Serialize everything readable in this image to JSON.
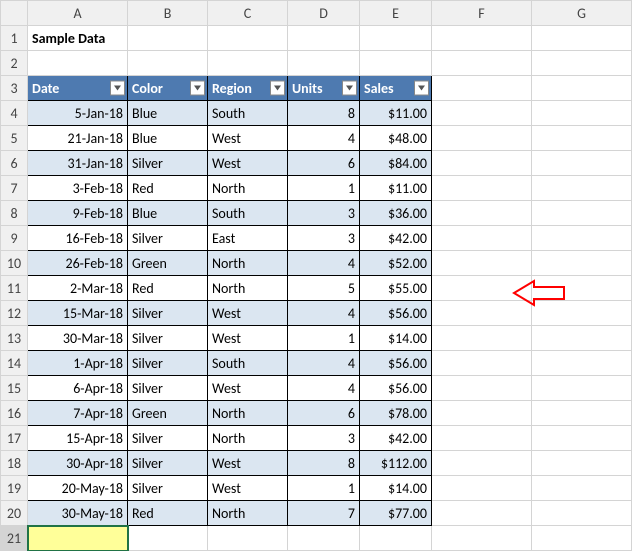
{
  "title_cell": "Sample Data",
  "columns": [
    "A",
    "B",
    "C",
    "D",
    "E",
    "F",
    "G"
  ],
  "row_numbers": [
    1,
    2,
    3,
    4,
    5,
    6,
    7,
    8,
    9,
    10,
    11,
    12,
    13,
    14,
    15,
    16,
    17,
    18,
    19,
    20,
    21
  ],
  "headers": {
    "date": "Date",
    "color": "Color",
    "region": "Region",
    "units": "Units",
    "sales": "Sales"
  },
  "rows": [
    {
      "date": "5-Jan-18",
      "color": "Blue",
      "region": "South",
      "units": "8",
      "sales": "$11.00"
    },
    {
      "date": "21-Jan-18",
      "color": "Blue",
      "region": "West",
      "units": "4",
      "sales": "$48.00"
    },
    {
      "date": "31-Jan-18",
      "color": "Silver",
      "region": "West",
      "units": "6",
      "sales": "$84.00"
    },
    {
      "date": "3-Feb-18",
      "color": "Red",
      "region": "North",
      "units": "1",
      "sales": "$11.00"
    },
    {
      "date": "9-Feb-18",
      "color": "Blue",
      "region": "South",
      "units": "3",
      "sales": "$36.00"
    },
    {
      "date": "16-Feb-18",
      "color": "Silver",
      "region": "East",
      "units": "3",
      "sales": "$42.00"
    },
    {
      "date": "26-Feb-18",
      "color": "Green",
      "region": "North",
      "units": "4",
      "sales": "$52.00"
    },
    {
      "date": "2-Mar-18",
      "color": "Red",
      "region": "North",
      "units": "5",
      "sales": "$55.00"
    },
    {
      "date": "15-Mar-18",
      "color": "Silver",
      "region": "West",
      "units": "4",
      "sales": "$56.00"
    },
    {
      "date": "30-Mar-18",
      "color": "Silver",
      "region": "West",
      "units": "1",
      "sales": "$14.00"
    },
    {
      "date": "1-Apr-18",
      "color": "Silver",
      "region": "South",
      "units": "4",
      "sales": "$56.00"
    },
    {
      "date": "6-Apr-18",
      "color": "Silver",
      "region": "West",
      "units": "4",
      "sales": "$56.00"
    },
    {
      "date": "7-Apr-18",
      "color": "Green",
      "region": "North",
      "units": "6",
      "sales": "$78.00"
    },
    {
      "date": "15-Apr-18",
      "color": "Silver",
      "region": "North",
      "units": "3",
      "sales": "$42.00"
    },
    {
      "date": "30-Apr-18",
      "color": "Silver",
      "region": "West",
      "units": "8",
      "sales": "$112.00"
    },
    {
      "date": "20-May-18",
      "color": "Silver",
      "region": "West",
      "units": "1",
      "sales": "$14.00"
    },
    {
      "date": "30-May-18",
      "color": "Red",
      "region": "North",
      "units": "7",
      "sales": "$77.00"
    }
  ]
}
